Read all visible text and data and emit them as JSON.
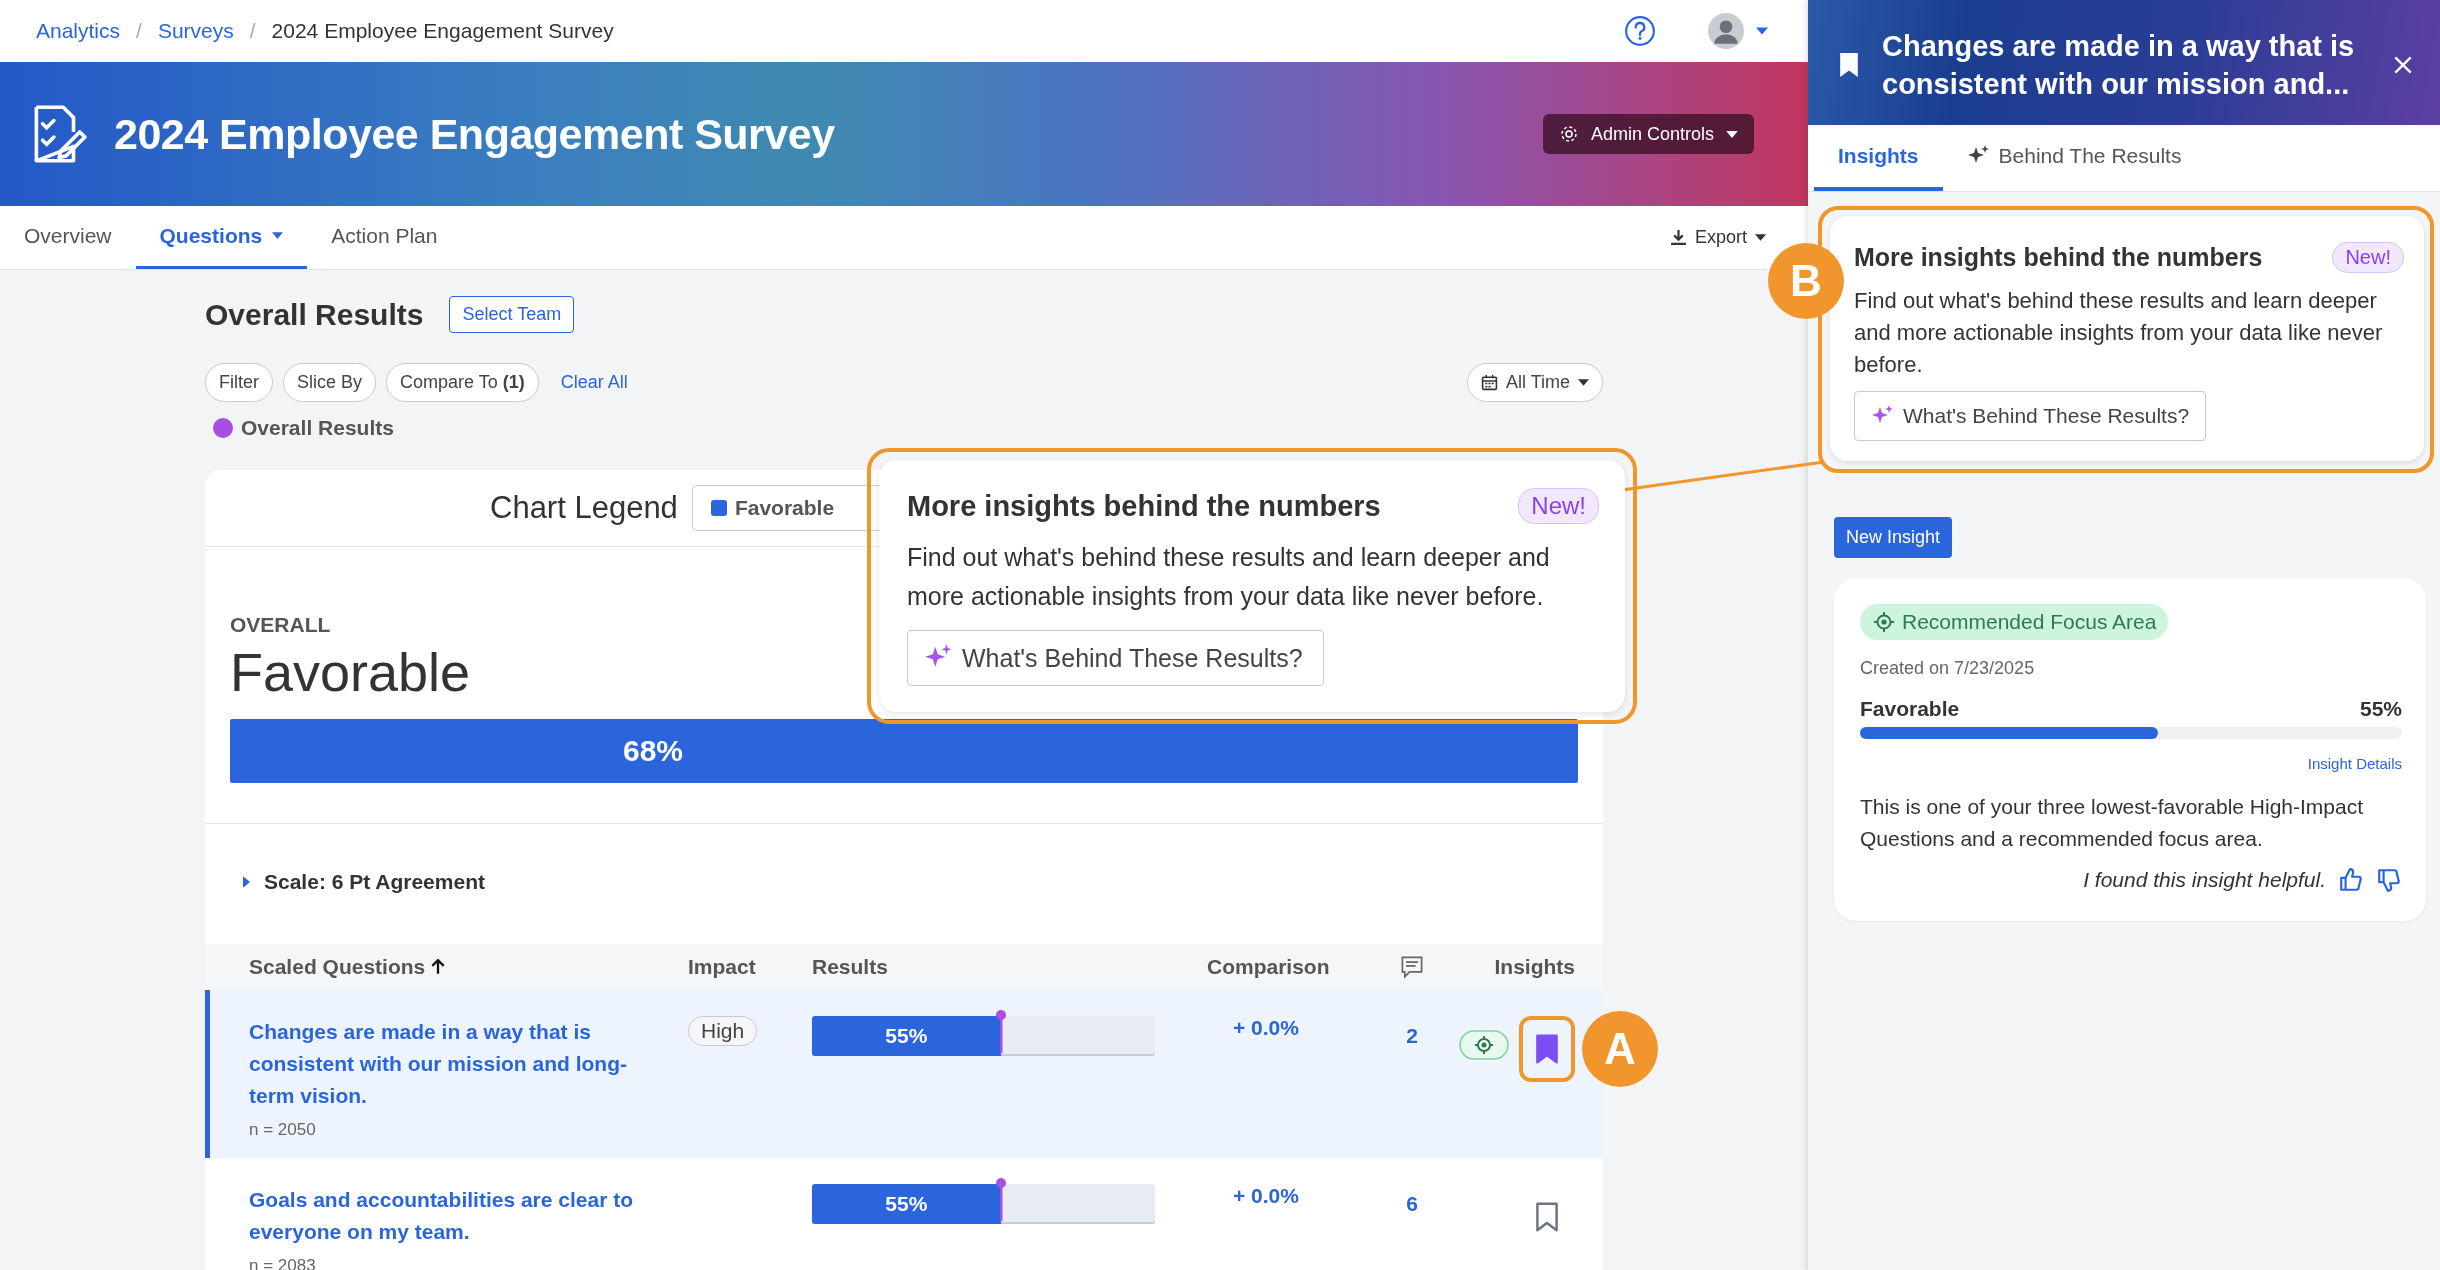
{
  "breadcrumbs": [
    {
      "label": "Analytics",
      "link": true
    },
    {
      "label": "Surveys",
      "link": true
    },
    {
      "label": "2024 Employee Engagement Survey",
      "link": false
    }
  ],
  "breadcrumb_separator": "/",
  "banner": {
    "title": "2024 Employee Engagement Survey",
    "admin_button": "Admin Controls"
  },
  "nav_tabs": [
    {
      "label": "Overview",
      "selected": false,
      "dropdown": false
    },
    {
      "label": "Questions",
      "selected": true,
      "dropdown": true
    },
    {
      "label": "Action Plan",
      "selected": false,
      "dropdown": false
    }
  ],
  "export": "Export",
  "results": {
    "title": "Overall Results",
    "select_team": "Select Team",
    "filters": [
      "Filter",
      "Slice By",
      "Compare To **(1)**"
    ],
    "clear_all": "Clear All",
    "date_range": "All Time",
    "series": {
      "label": "Overall Results",
      "color": "#a74fe0"
    }
  },
  "chart": {
    "legend_label": "Chart Legend",
    "legend_item": {
      "label": "Favorable",
      "color": "#2a65dc"
    },
    "overall_label": "OVERALL",
    "metric": "Favorable",
    "value": "68%"
  },
  "scale": {
    "label": "Scale: 6 Pt Agreement",
    "expanded": false
  },
  "table": {
    "headers": {
      "question": "Scaled Questions",
      "impact": "Impact",
      "results": "Results",
      "comparison": "Comparison",
      "insights": "Insights"
    },
    "rows": [
      {
        "question": "Changes are made in a way that is consistent with our mission and long-term vision.",
        "n": "n = 2050",
        "impact": "High",
        "result": "55%",
        "level": 0.55,
        "comparison": "+ 0.0%",
        "comments": "2",
        "focus_area": true,
        "bookmarked": true,
        "selected": true,
        "highlighted": true
      },
      {
        "question": "Goals and accountabilities are clear to everyone on my team.",
        "n": "n = 2083",
        "result": "55%",
        "level": 0.55,
        "comparison": "+ 0.0%",
        "comments": "6",
        "focus_area": false,
        "bookmarked": false,
        "selected": false,
        "highlighted": false
      }
    ]
  },
  "annotations": [
    "A",
    "B"
  ],
  "callout": {
    "title": "More insights behind the numbers",
    "badge": "New!",
    "body": "Find out what's behind these results and learn deeper and more actionable insights from your data like never before.",
    "button": "What's Behind These Results?"
  },
  "panel": {
    "title": "Changes are made in a way that is consistent with our mission and...",
    "tabs": [
      {
        "label": "Insights",
        "selected": true,
        "sparkle": false
      },
      {
        "label": "Behind The Results",
        "selected": false,
        "sparkle": true
      }
    ],
    "card": {
      "title": "More insights behind the numbers",
      "badge": "New!",
      "body": "Find out what's behind these results and learn deeper and more actionable insights from your data like never before.",
      "button": "What's Behind These Results?"
    },
    "new_insight": "New Insight",
    "insight": {
      "tag": "Recommended Focus Area",
      "created": "Created on 7/23/2025",
      "metric": "Favorable",
      "value": "55%",
      "level": 0.55,
      "details_link": "Insight Details",
      "description": "This is one of your three lowest-favorable High-Impact Questions and a recommended focus area.",
      "feedback": "I found this insight helpful."
    }
  }
}
